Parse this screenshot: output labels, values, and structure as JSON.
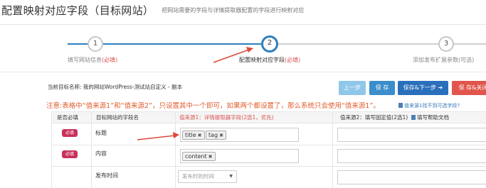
{
  "header": {
    "title": "配置映射对应字段（目标网站）",
    "subtitle": "把网站需要的字段与详情提取器配置的字段进行映射对应"
  },
  "wizard": {
    "steps": [
      {
        "number": "1",
        "label": "填写网站信息",
        "required": "(必填)"
      },
      {
        "number": "2",
        "label": "配置映射对应字段",
        "required": "(必填)"
      },
      {
        "number": "3",
        "label": "添加发布扩展参数",
        "required": "(可选)"
      }
    ],
    "colors": {
      "done": "#2e7fbe",
      "pending": "#cccccc",
      "arrow": "#e0483a"
    }
  },
  "task": {
    "name": "当前目标名称: 我的网站WordPress-测试站自定义 - 副本"
  },
  "toolbar": {
    "prev_label": "上一步",
    "save_label": "保 存",
    "save_next_label": "保存&下一步 ➔",
    "save_close_label": "保 存&关闭"
  },
  "notice": "注意:表格中“值来源1”和“值来源2”，只设置其中一个即可，如果两个都设置了，那么系统只会使用“值来源1”。",
  "help_link": "值来源1找不到可选字段?",
  "table": {
    "headers": {
      "required": "是否必填",
      "field": "目标网站的字段名",
      "source1": "值来源1：详情提取器字段(2选1，优先)",
      "source2": "值来源2：填写固定值(2选1)",
      "help_doc": "填写帮助文档"
    },
    "rows": [
      {
        "required_badge": "必填",
        "field": "标题",
        "tags": [
          "title",
          "tag"
        ]
      },
      {
        "required_badge": "必填",
        "field": "内容",
        "tags": [
          "content"
        ]
      },
      {
        "field": "发布时间",
        "select_value": "发布时的时间"
      }
    ]
  }
}
